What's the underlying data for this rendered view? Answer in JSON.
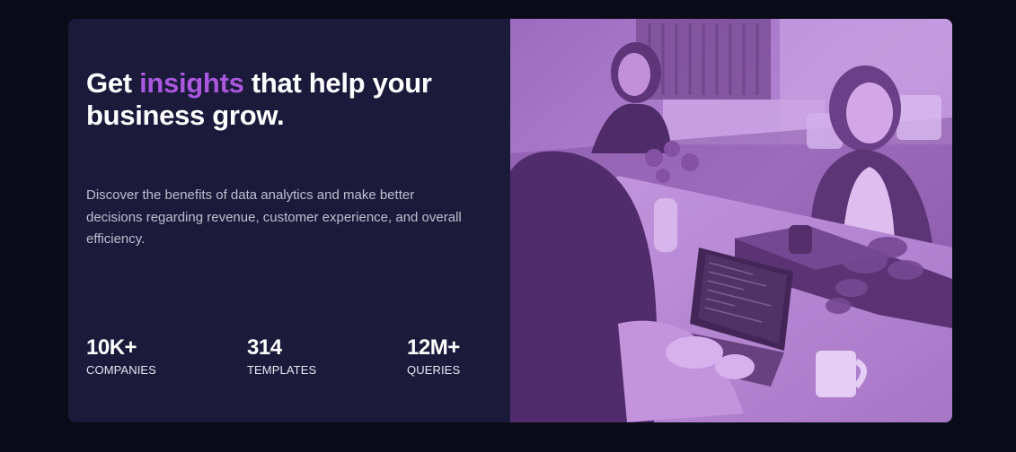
{
  "hero": {
    "title_pre": "Get ",
    "title_accent": "insights",
    "title_post": " that help your business grow.",
    "description": "Discover the benefits of data analytics and make better decisions regarding revenue, customer experience, and overall efficiency."
  },
  "stats": [
    {
      "value": "10K+",
      "label": "COMPANIES"
    },
    {
      "value": "314",
      "label": "TEMPLATES"
    },
    {
      "value": "12M+",
      "label": "QUERIES"
    }
  ],
  "image": {
    "icon": "office-team-photo",
    "tint": "#aa5cdb"
  },
  "colors": {
    "page_bg": "#090b19",
    "card_bg": "#1b1a3b",
    "accent": "#a958dd",
    "text": "#ffffff",
    "muted_text": "#bfbecf"
  }
}
